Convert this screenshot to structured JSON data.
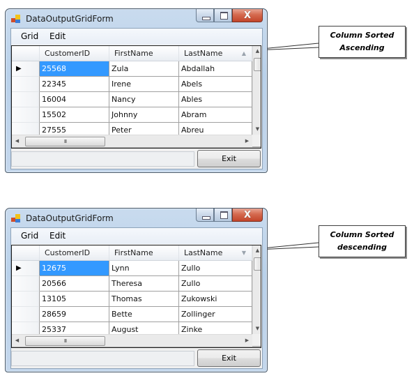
{
  "windows": [
    {
      "title": "DataOutputGridForm",
      "menu": [
        "Grid",
        "Edit"
      ],
      "columns": [
        "CustomerID",
        "FirstName",
        "LastName"
      ],
      "sort": {
        "column": "LastName",
        "direction": "ascending",
        "glyph": "▲"
      },
      "rows": [
        [
          "25568",
          "Zula",
          "Abdallah"
        ],
        [
          "22345",
          "Irene",
          "Abels"
        ],
        [
          "16004",
          "Nancy",
          "Ables"
        ],
        [
          "15502",
          "Johnny",
          "Abram"
        ],
        [
          "27555",
          "Peter",
          "Abreu"
        ]
      ],
      "selected_row": 0,
      "exit_label": "Exit",
      "scroll": {
        "up": "▲",
        "down": "▼",
        "left": "◀",
        "right": "▶",
        "grip": "III"
      },
      "row_pointer": "▶",
      "caption": {
        "close": "X"
      },
      "callout": {
        "line1": "Column Sorted",
        "line2": "Ascending"
      }
    },
    {
      "title": "DataOutputGridForm",
      "menu": [
        "Grid",
        "Edit"
      ],
      "columns": [
        "CustomerID",
        "FirstName",
        "LastName"
      ],
      "sort": {
        "column": "LastName",
        "direction": "descending",
        "glyph": "▼"
      },
      "rows": [
        [
          "12675",
          "Lynn",
          "Zullo"
        ],
        [
          "20566",
          "Theresa",
          "Zullo"
        ],
        [
          "13105",
          "Thomas",
          "Zukowski"
        ],
        [
          "28659",
          "Bette",
          "Zollinger"
        ],
        [
          "25337",
          "August",
          "Zinke"
        ]
      ],
      "selected_row": 0,
      "exit_label": "Exit",
      "scroll": {
        "up": "▲",
        "down": "▼",
        "left": "◀",
        "right": "▶",
        "grip": "III"
      },
      "row_pointer": "▶",
      "caption": {
        "close": "X"
      },
      "callout": {
        "line1": "Column Sorted",
        "line2": "descending"
      }
    }
  ]
}
